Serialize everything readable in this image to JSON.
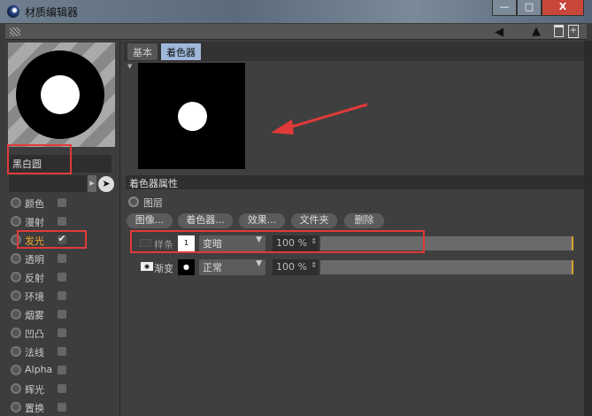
{
  "window": {
    "title": "材质编辑器",
    "minimize": "—",
    "maximize": "□",
    "close": "X"
  },
  "toolbar": {
    "icons": [
      "back-arrow-icon",
      "up-arrow-icon",
      "lock-icon",
      "new-window-icon"
    ]
  },
  "material": {
    "name": "黑白圆"
  },
  "channels": [
    {
      "label": "颜色",
      "checked": false
    },
    {
      "label": "漫射",
      "checked": false
    },
    {
      "label": "发光",
      "checked": true,
      "check_mark": "✔"
    },
    {
      "label": "透明",
      "checked": false
    },
    {
      "label": "反射",
      "checked": false
    },
    {
      "label": "环境",
      "checked": false
    },
    {
      "label": "烟雾",
      "checked": false
    },
    {
      "label": "凹凸",
      "checked": false
    },
    {
      "label": "法线",
      "checked": false
    },
    {
      "label": "Alpha",
      "checked": false
    },
    {
      "label": "辉光",
      "checked": false
    },
    {
      "label": "置换",
      "checked": false
    }
  ],
  "tabs": [
    {
      "label": "基本",
      "active": false
    },
    {
      "label": "着色器",
      "active": true
    }
  ],
  "shader": {
    "section_title": "着色器属性",
    "layer_label": "图层",
    "buttons": [
      "图像...",
      "着色器...",
      "效果...",
      "文件夹",
      "删除"
    ],
    "layers": [
      {
        "name": "样条",
        "swatch": "1",
        "mode": "变暗",
        "opacity": "100 %"
      },
      {
        "name": "渐变",
        "swatch": "●",
        "mode": "正常",
        "opacity": "100 %"
      }
    ]
  },
  "colors": {
    "highlight": "#e03a3a",
    "active_channel": "#f0a830",
    "tab_active": "#9fb7d9"
  }
}
